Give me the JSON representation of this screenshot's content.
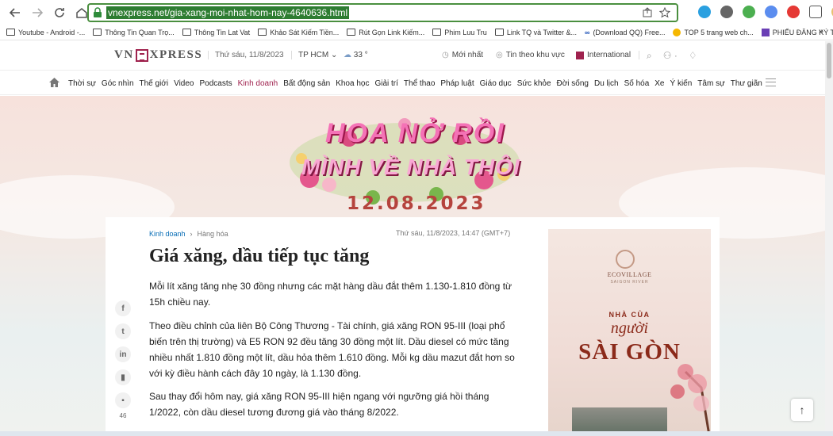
{
  "browser": {
    "url": "vnexpress.net/gia-xang-moi-nhat-hom-nay-4640636.html",
    "bookmarks": [
      "Youtube - Android -...",
      "Thông Tin Quan Trọ...",
      "Thông Tin Lat Vat",
      "Khảo Sát Kiếm Tiền...",
      "Rút Gọn Link Kiếm...",
      "Phim Luu Tru",
      "Link TQ và Twitter &...",
      "(Download QQ) Free...",
      "TOP 5 trang web ch...",
      "PHIẾU ĐĂNG KÝ TH..."
    ],
    "bookmarks_more": "»"
  },
  "header": {
    "logo_left": "VN",
    "logo_right": "XPRESS",
    "date": "Thứ sáu, 11/8/2023",
    "city": "TP HCM",
    "temperature": "33 °",
    "latest": "Mới nhất",
    "region_news": "Tin theo khu vực",
    "international": "International"
  },
  "nav": {
    "items": [
      "Thời sự",
      "Góc nhìn",
      "Thế giới",
      "Video",
      "Podcasts",
      "Kinh doanh",
      "Bất động sản",
      "Khoa học",
      "Giải trí",
      "Thể thao",
      "Pháp luật",
      "Giáo dục",
      "Sức khỏe",
      "Đời sống",
      "Du lịch",
      "Số hóa",
      "Xe",
      "Ý kiến",
      "Tâm sự",
      "Thư giãn"
    ],
    "active": "Kinh doanh"
  },
  "banner": {
    "title1": "HOA NỞ RỒI",
    "title2": "MÌNH VỀ NHÀ THÔI",
    "date": "12.08.2023"
  },
  "article": {
    "breadcrumb_section": "Kinh doanh",
    "breadcrumb_sub": "Hàng hóa",
    "time": "Thứ sáu, 11/8/2023, 14:47 (GMT+7)",
    "title": "Giá xăng, dầu tiếp tục tăng",
    "lead": "Mỗi lít xăng tăng nhẹ 30 đồng nhưng các mặt hàng dầu đắt thêm 1.130-1.810 đồng từ 15h chiều nay.",
    "p1": "Theo điều chỉnh của liên Bộ Công Thương - Tài chính, giá xăng RON 95-III (loại phổ biến trên thị trường) và E5 RON 92 đều tăng 30 đồng một lít. Dầu diesel có mức tăng nhiều nhất 1.810 đồng một lít, dầu hỏa thêm 1.610 đồng. Mỗi kg dầu mazut đắt hơn so với kỳ điều hành cách đây 10 ngày, là 1.130 đồng.",
    "p2": "Sau thay đổi hôm nay, giá xăng RON 95-III hiện ngang với ngưỡng giá hồi tháng 1/2022, còn dầu diesel tương đương giá vào tháng 8/2022.",
    "comment_count": "46"
  },
  "ad": {
    "brand": "ECOVILLAGE",
    "sub": "SAIGON RIVER",
    "line1": "NHÀ CỦA",
    "line2": "người",
    "line3": "SÀI GÒN"
  },
  "colors": {
    "brand": "#9f224e",
    "link": "#076db6"
  }
}
